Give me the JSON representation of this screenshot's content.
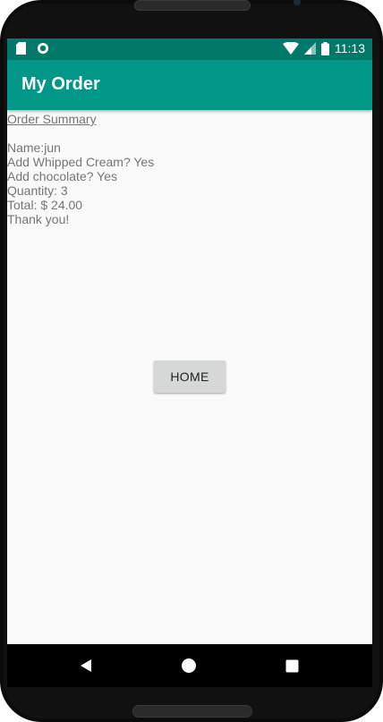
{
  "statusbar": {
    "time": "11:13",
    "icons": [
      "sd-card-icon",
      "circle-notification-icon",
      "wifi-icon",
      "cellular-signal-icon",
      "battery-icon"
    ]
  },
  "appbar": {
    "title": "My Order"
  },
  "order": {
    "summary_title": "Order Summary",
    "name_line": "Name:jun",
    "whipped_cream_line": "Add Whipped Cream? Yes",
    "chocolate_line": "Add chocolate? Yes",
    "quantity_line": "Quantity: 3",
    "total_line": "Total: $ 24.00",
    "thanks_line": "Thank you!"
  },
  "home_button": {
    "label": "HOME"
  },
  "navbar": {
    "icons": [
      "back-icon",
      "home-icon",
      "recents-icon"
    ]
  },
  "colors": {
    "statusbar": "#00796b",
    "appbar": "#009688",
    "background": "#fafafa",
    "text": "#757575",
    "button": "#d6d7d7"
  }
}
